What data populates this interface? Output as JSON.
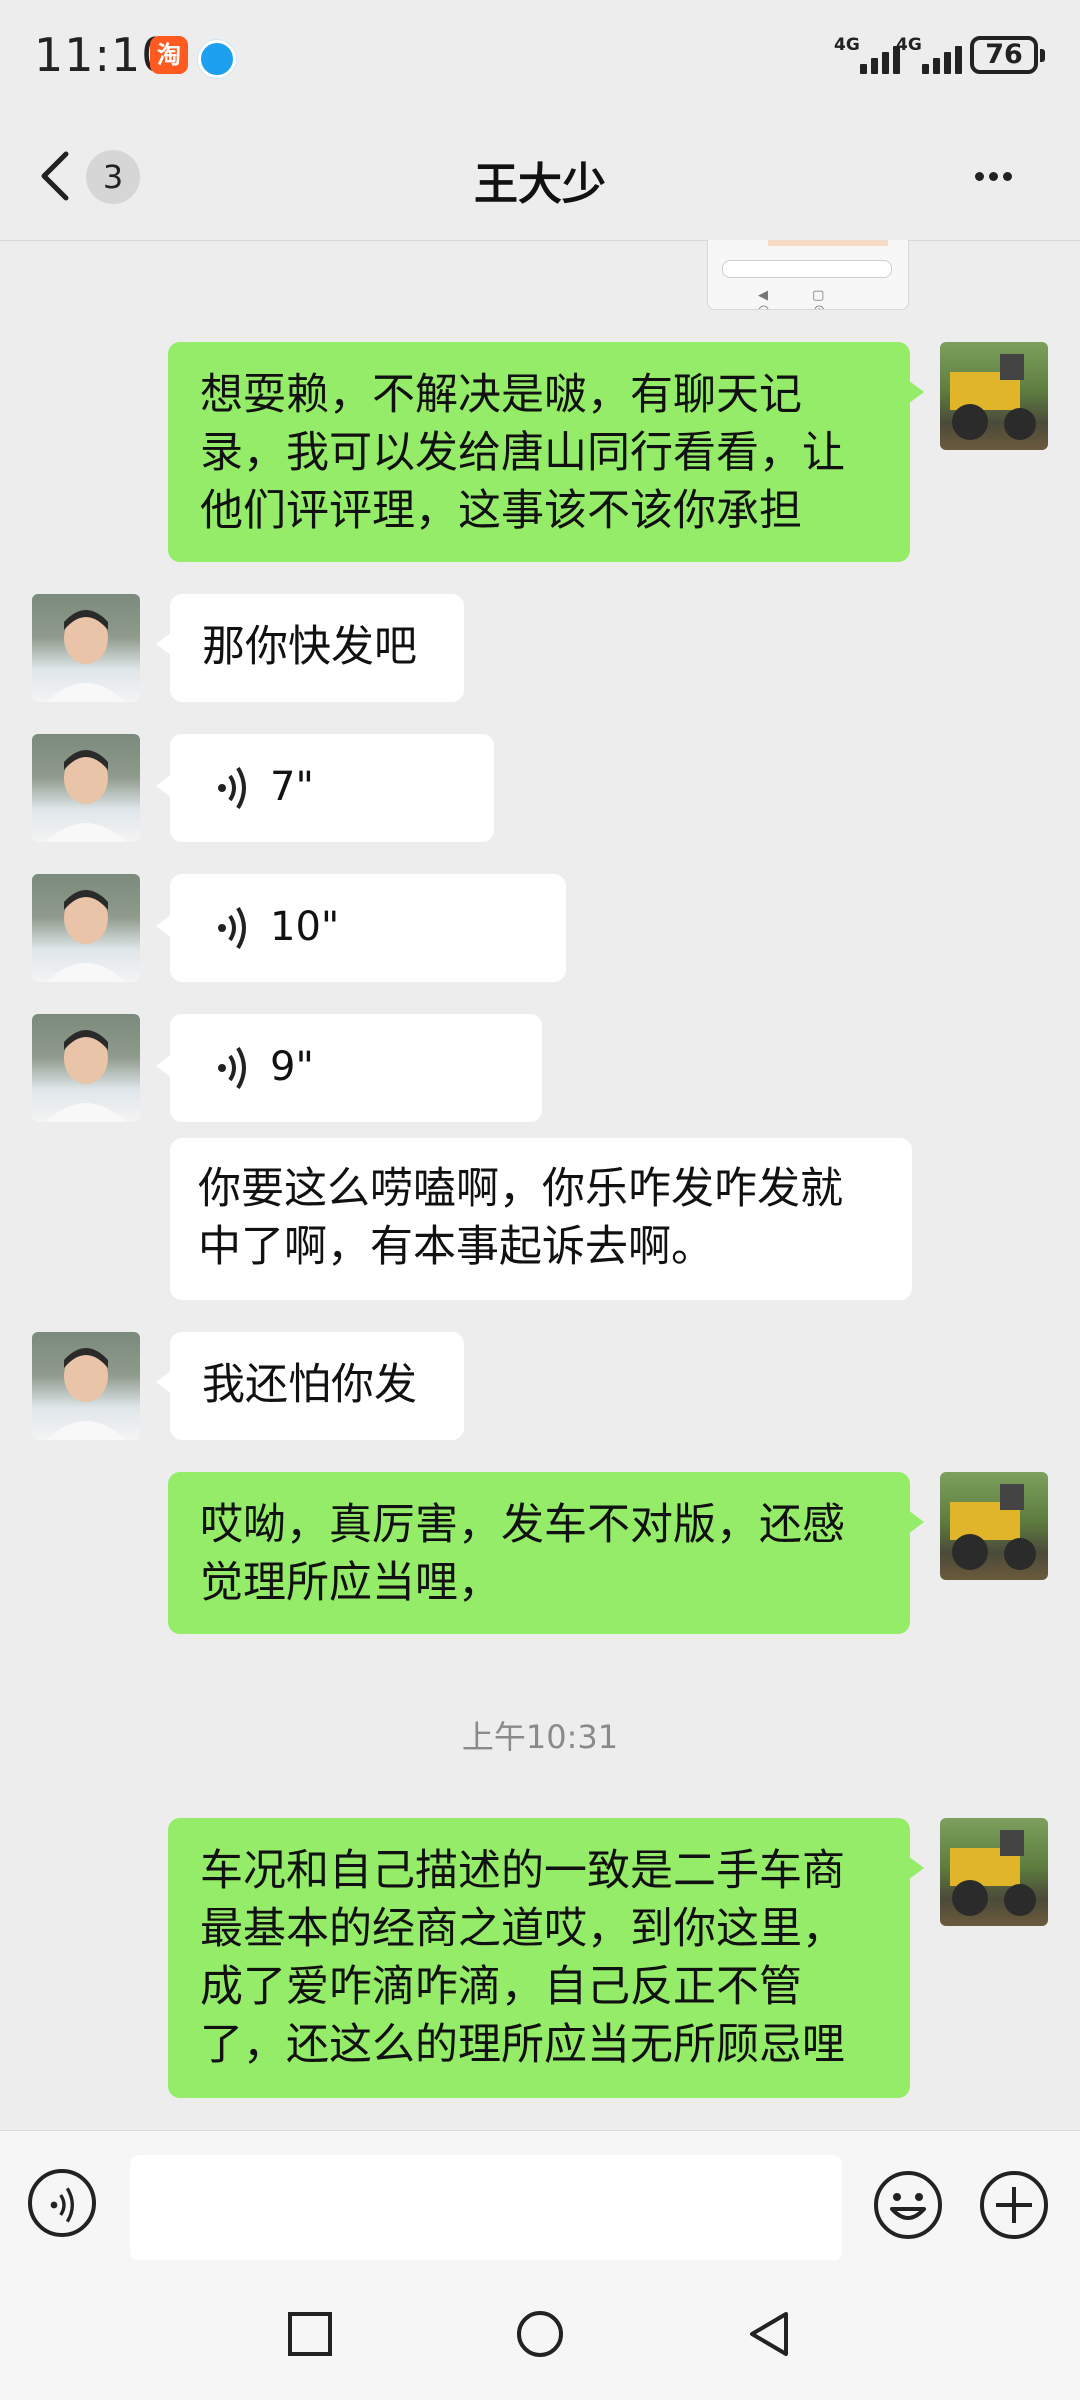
{
  "status_bar": {
    "time": "11:10",
    "app_icons": [
      "taobao-icon",
      "browser-icon"
    ],
    "signal_1": "4G",
    "signal_2": "4G",
    "battery": "76"
  },
  "nav": {
    "unread_count": "3",
    "title": "王大少"
  },
  "messages": [
    {
      "side": "out",
      "type": "image",
      "icon": "image-thumbnail"
    },
    {
      "side": "out",
      "type": "text",
      "text": "想耍赖，不解决是啵，有聊天记录，我可以发给唐山同行看看，让他们评评理，这事该不该你承担"
    },
    {
      "side": "in",
      "type": "text",
      "text": "那你快发吧"
    },
    {
      "side": "in",
      "type": "voice",
      "duration": "7\""
    },
    {
      "side": "in",
      "type": "voice",
      "duration": "10\""
    },
    {
      "side": "in",
      "type": "voice",
      "duration": "9\""
    },
    {
      "side": "in",
      "type": "text",
      "text": "你要这么唠嗑啊，你乐咋发咋发就中了啊，有本事起诉去啊。"
    },
    {
      "side": "in",
      "type": "text",
      "text": "我还怕你发"
    },
    {
      "side": "out",
      "type": "text",
      "text": "哎呦，真厉害，发车不对版，还感觉理所应当哩，"
    },
    {
      "side": "out",
      "type": "text",
      "text": "车况和自己描述的一致是二手车商最基本的经商之道哎，到你这里，成了爱咋滴咋滴，自己反正不管了，还这么的理所应当无所顾忌哩"
    }
  ],
  "timestamp": "上午10:31",
  "input_bar": {
    "placeholder": "",
    "value": ""
  },
  "colors": {
    "background": "#ededed",
    "outgoing_bubble": "#95ec69",
    "incoming_bubble": "#ffffff"
  }
}
